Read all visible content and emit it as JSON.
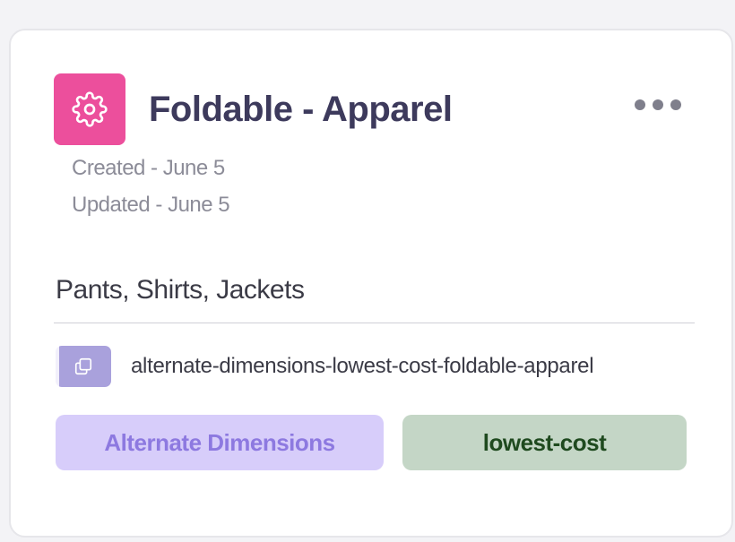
{
  "card": {
    "title": "Foldable - Apparel",
    "icon": "gear-icon",
    "icon_bg": "#ec4f9c",
    "menu_icon": "more-horizontal-icon",
    "created": "Created - June 5",
    "updated": "Updated - June 5",
    "categories": "Pants, Shirts, Jackets",
    "slug": "alternate-dimensions-lowest-cost-foldable-apparel",
    "copy_icon": "copy-icon",
    "tags": [
      {
        "label": "Alternate Dimensions",
        "bg": "#d7cdfa",
        "color": "#8d79e0"
      },
      {
        "label": "lowest-cost",
        "bg": "#c4d6c6",
        "color": "#1f4a1f"
      }
    ]
  }
}
